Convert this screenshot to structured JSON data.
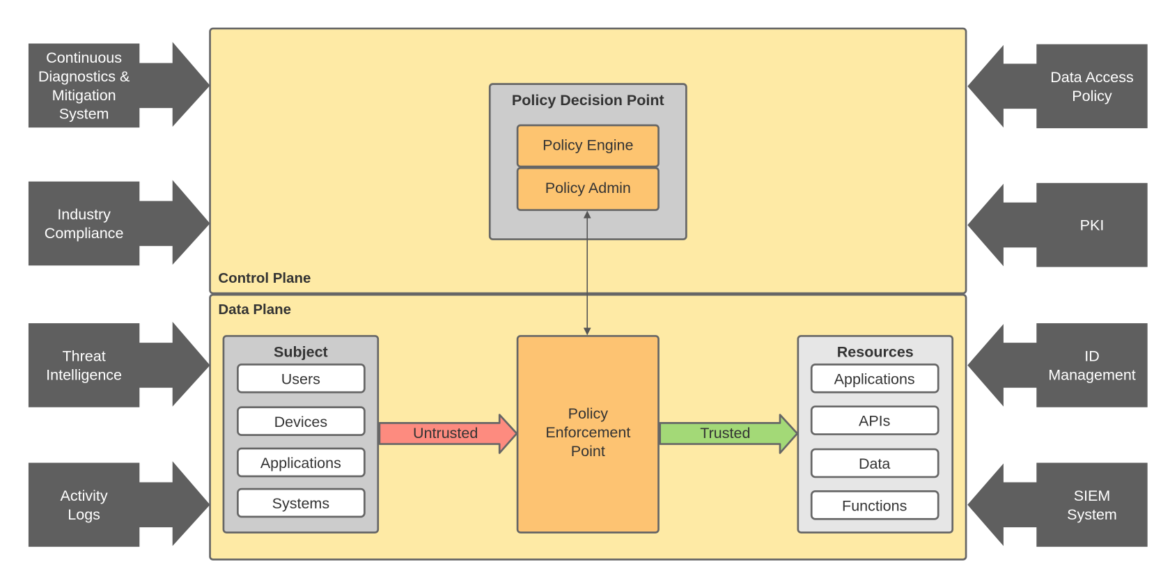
{
  "colors": {
    "plane_fill": "#feeaa5",
    "input_arrow": "#5f5f5f",
    "pdp_fill": "#cccccc",
    "policy_component": "#fdc470",
    "pep_fill": "#fdc372",
    "resources_fill": "#e6e6e6",
    "untrusted": "#fd8b7f",
    "trusted": "#a3d977"
  },
  "left_inputs": [
    {
      "lines": [
        "Continuous",
        "Diagnostics &",
        "Mitigation",
        "System"
      ]
    },
    {
      "lines": [
        "Industry",
        "Compliance"
      ]
    },
    {
      "lines": [
        "Threat",
        "Intelligence"
      ]
    },
    {
      "lines": [
        "Activity",
        "Logs"
      ]
    }
  ],
  "right_inputs": [
    {
      "lines": [
        "Data Access",
        "Policy"
      ]
    },
    {
      "lines": [
        "PKI"
      ]
    },
    {
      "lines": [
        "ID",
        "Management"
      ]
    },
    {
      "lines": [
        "SIEM",
        "System"
      ]
    }
  ],
  "control_plane": {
    "label": "Control Plane",
    "pdp": {
      "title": "Policy Decision Point",
      "engine": "Policy Engine",
      "admin": "Policy Admin"
    }
  },
  "data_plane": {
    "label": "Data Plane",
    "subject": {
      "title": "Subject",
      "items": [
        "Users",
        "Devices",
        "Applications",
        "Systems"
      ]
    },
    "pep": {
      "lines": [
        "Policy",
        "Enforcement",
        "Point"
      ]
    },
    "resources": {
      "title": "Resources",
      "items": [
        "Applications",
        "APIs",
        "Data",
        "Functions"
      ]
    },
    "untrusted_label": "Untrusted",
    "trusted_label": "Trusted"
  }
}
